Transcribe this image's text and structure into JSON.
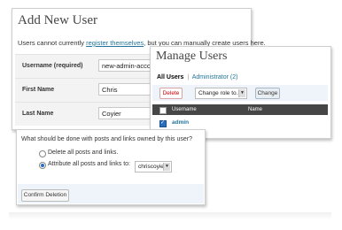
{
  "add_user": {
    "title": "Add New User",
    "notice_prefix": "Users cannot currently ",
    "notice_link": "register themselves",
    "notice_suffix": ", but you can manually create users here.",
    "fields": [
      {
        "label": "Username (required)",
        "value": "new-admin-account"
      },
      {
        "label": "First Name",
        "value": "Chris"
      },
      {
        "label": "Last Name",
        "value": "Coyier"
      }
    ]
  },
  "manage_users": {
    "title": "Manage Users",
    "filter_all": "All Users",
    "filter_sep": "|",
    "filter_admin": "Administrator (2)",
    "delete_label": "Delete",
    "role_select": "Change role to…",
    "change_label": "Change",
    "col_username": "Username",
    "col_name": "Name",
    "row_username": "admin"
  },
  "confirm": {
    "question": "What should be done with posts and links owned by this user?",
    "option_delete": "Delete all posts and links.",
    "option_attribute": "Attribute all posts and links to:",
    "attribute_user": "chriscoyier",
    "confirm_label": "Confirm Deletion"
  }
}
